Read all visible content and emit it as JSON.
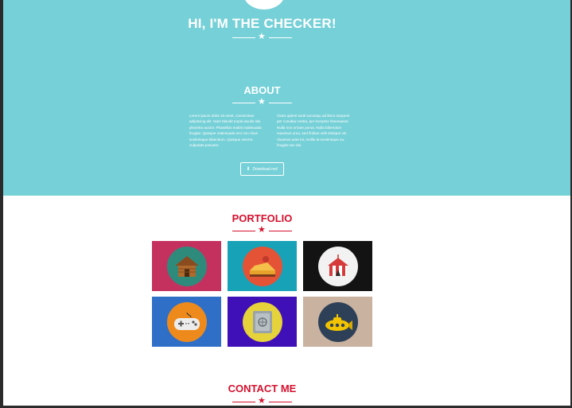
{
  "colors": {
    "header_bg": "#76d0d7",
    "accent": "#d5112d",
    "white": "#ffffff"
  },
  "header": {
    "title": "HI, I'M THE CHECKER!",
    "divider_icon": "star-icon"
  },
  "about": {
    "title": "ABOUT",
    "col_left": "Lorem ipsum dolor sit amet, consectetur adipiscing elit. Nam blandit turpis iaculis nisi pharetra auctor. Phasellus mattis malesuada feugiat. Quisque malesuada orci non risus scelerisque bibendum. Quisque viverra vulputate posuere.",
    "col_right": "Class aptent taciti sociosqu ad litora torquent per conubia nostra, per inceptos himenaeos. Nulla non ornare purus. Nulla bibendum maximus urna, sed finibus velit tristique vel. Vivamus ante mi, mollis at scelerisque eu, feugiat non dui.",
    "download_label": "Download me!"
  },
  "portfolio": {
    "title": "PORTFOLIO",
    "tiles": [
      {
        "name": "cabin",
        "bg": "#c4315e",
        "icon_bg": "#2e8b7c"
      },
      {
        "name": "cake",
        "bg": "#17a2b8",
        "icon_bg": "#e55336"
      },
      {
        "name": "circus",
        "bg": "#131313",
        "icon_bg": "#f2f2f2"
      },
      {
        "name": "game-controller",
        "bg": "#2f6fc7",
        "icon_bg": "#ee8a1b"
      },
      {
        "name": "safe",
        "bg": "#3f0fb8",
        "icon_bg": "#e6d23a"
      },
      {
        "name": "submarine",
        "bg": "#c9b29f",
        "icon_bg": "#2e4058"
      }
    ]
  },
  "contact": {
    "title": "CONTACT ME"
  }
}
